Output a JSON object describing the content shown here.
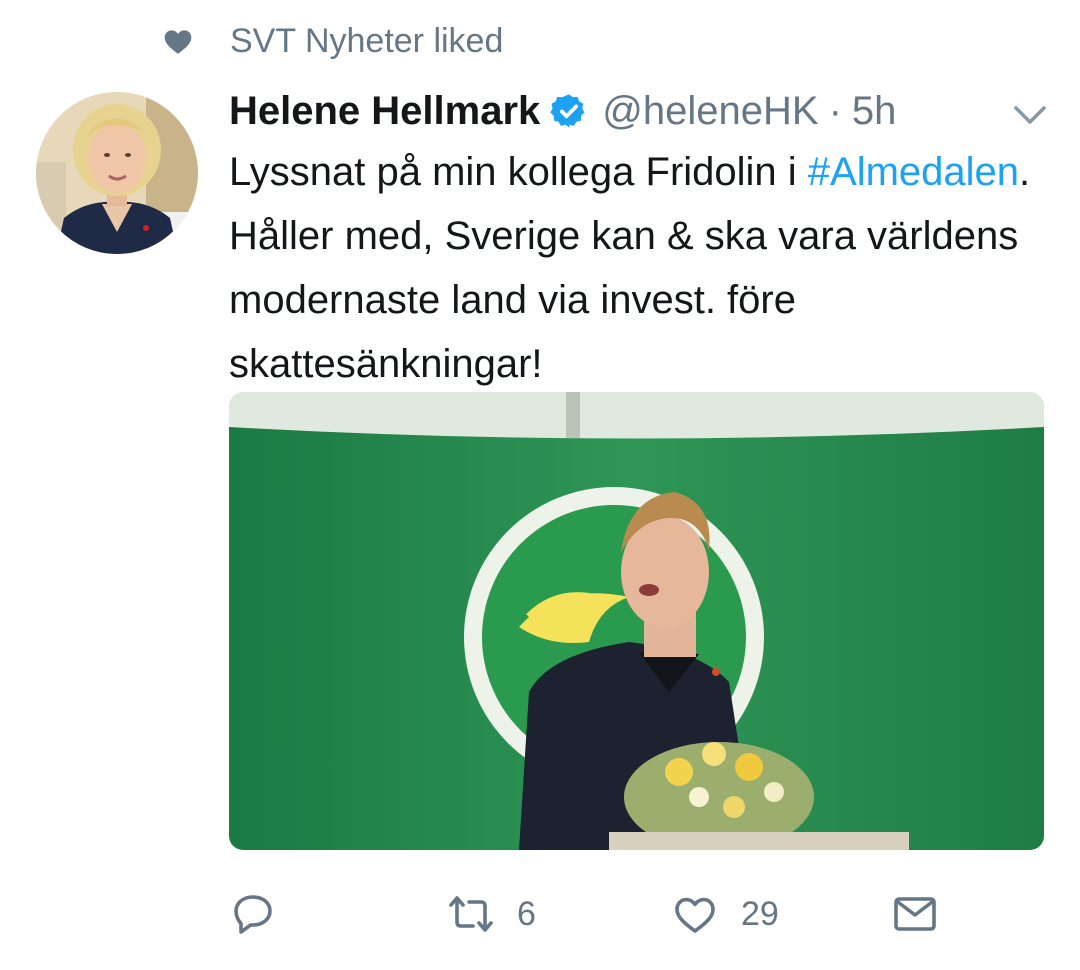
{
  "social_context": {
    "text": "SVT Nyheter liked",
    "icon": "heart-icon"
  },
  "tweet": {
    "author_name": "Helene Hellmark",
    "verified": true,
    "handle": "@heleneHK",
    "separator": "·",
    "time": "5h",
    "text_before": "Lyssnat på min kollega Fridolin i ",
    "hashtag": "#Almedalen",
    "text_after": ". Håller med, Sverige kan & ska vara världens modernaste land via invest. före skattesänkningar!"
  },
  "actions": {
    "reply": {
      "icon": "reply-icon"
    },
    "retweet": {
      "icon": "retweet-icon",
      "count": "6"
    },
    "like": {
      "icon": "like-icon",
      "count": "29"
    },
    "dm": {
      "icon": "direct-message-icon"
    }
  },
  "colors": {
    "link": "#1da1f2",
    "secondary_text": "#657786",
    "verified_badge": "#1da1f2"
  }
}
